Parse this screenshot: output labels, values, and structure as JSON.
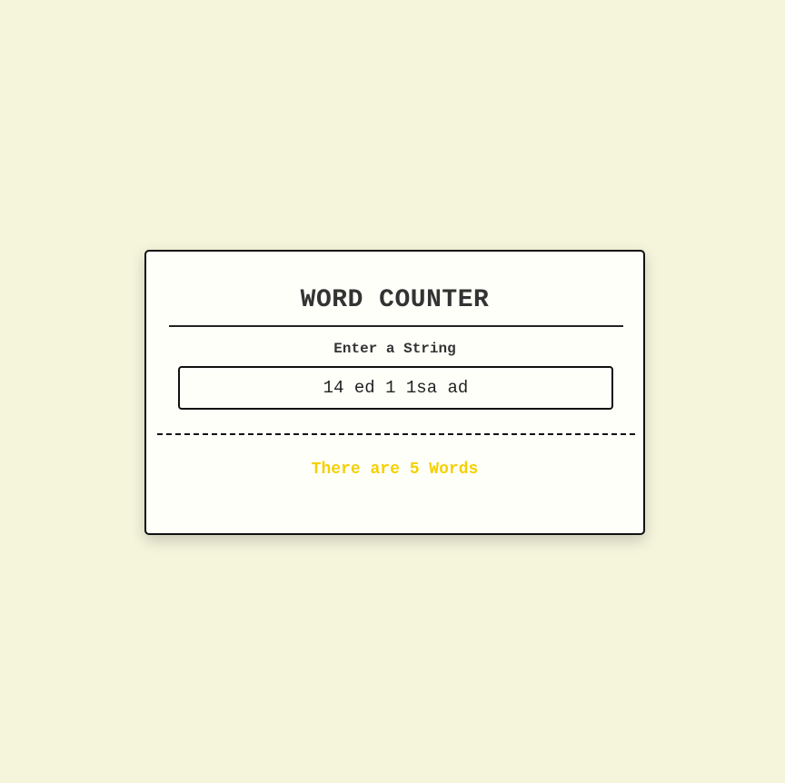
{
  "app": {
    "title": "WORD COUNTER",
    "input_label": "Enter a String",
    "input_value": "14 ed 1 1sa ad",
    "result_text": "There are 5 Words"
  },
  "colors": {
    "background": "#f5f5dc",
    "card": "#fffffa",
    "result": "#f5d000"
  }
}
